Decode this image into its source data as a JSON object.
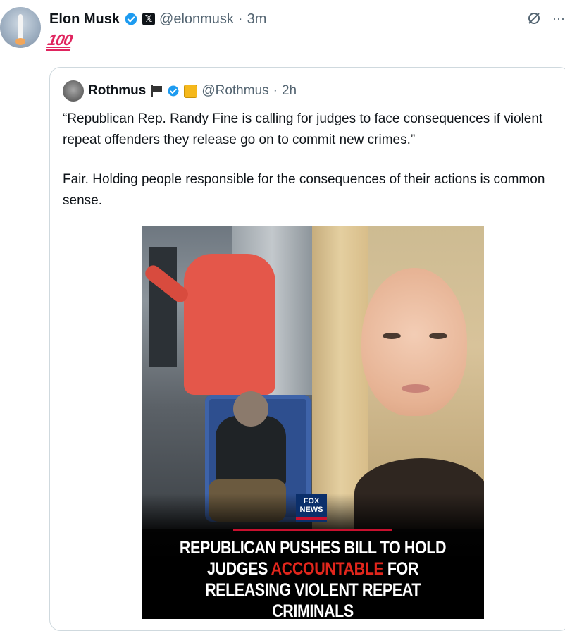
{
  "post": {
    "author_name": "Elon Musk",
    "handle": "@elonmusk",
    "separator": "·",
    "time": "3m",
    "text_emoji": "100",
    "icons": [
      "verified-badge-icon",
      "x-affiliate-icon",
      "grok-icon",
      "more-icon"
    ]
  },
  "quote": {
    "author_name": "Rothmus",
    "handle": "@Rothmus",
    "separator": "·",
    "time": "2h",
    "paragraph1": "“Republican Rep. Randy Fine is calling for judges to face consequences if violent repeat offenders they release go on to commit new crimes.”",
    "paragraph2": "Fair. Holding people responsible for the consequences of their actions is common sense.",
    "media": {
      "logo_line1": "FOX",
      "logo_line2": "NEWS",
      "headline_part1": "REPUBLICAN PUSHES BILL TO HOLD JUDGES ",
      "headline_highlight": "ACCOUNTABLE",
      "headline_part2": " FOR RELEASING VIOLENT REPEAT CRIMINALS"
    }
  },
  "colors": {
    "verified_blue": "#1d9bf0",
    "accent_red": "#e1261c",
    "muted_gray": "#536471"
  }
}
